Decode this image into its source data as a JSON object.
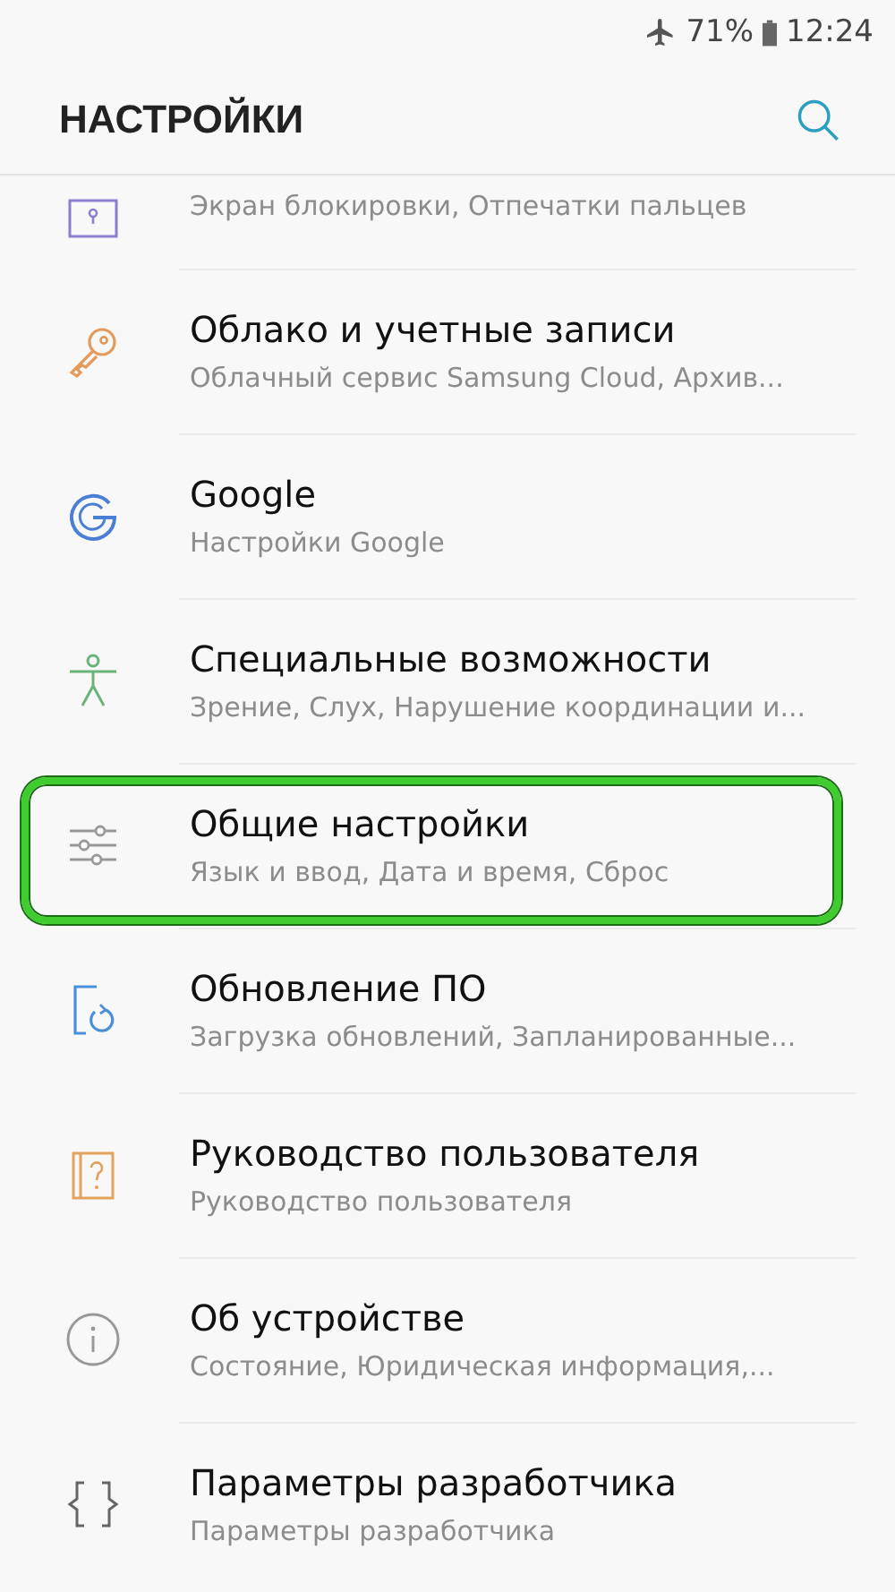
{
  "status_bar": {
    "airplane_mode": true,
    "battery": "71%",
    "time": "12:24"
  },
  "header": {
    "title": "НАСТРОЙКИ"
  },
  "items": [
    {
      "subtitle": "Экран блокировки, Отпечатки пальцев",
      "highlighted": false
    },
    {
      "title": "Облако и учетные записи",
      "subtitle": "Облачный сервис Samsung Cloud, Архив...",
      "highlighted": false
    },
    {
      "title": "Google",
      "subtitle": "Настройки Google",
      "highlighted": false
    },
    {
      "title": "Специальные возможности",
      "subtitle": "Зрение, Слух, Нарушение координации и...",
      "highlighted": false
    },
    {
      "title": "Общие настройки",
      "subtitle": "Язык и ввод, Дата и время, Сброс",
      "highlighted": true
    },
    {
      "title": "Обновление ПО",
      "subtitle": "Загрузка обновлений, Запланированные...",
      "highlighted": false
    },
    {
      "title": "Руководство пользователя",
      "subtitle": "Руководство пользователя",
      "highlighted": false
    },
    {
      "title": "Об устройстве",
      "subtitle": "Состояние, Юридическая информация,...",
      "highlighted": false
    },
    {
      "title": "Параметры разработчика",
      "subtitle": "Параметры разработчика",
      "highlighted": false
    }
  ]
}
